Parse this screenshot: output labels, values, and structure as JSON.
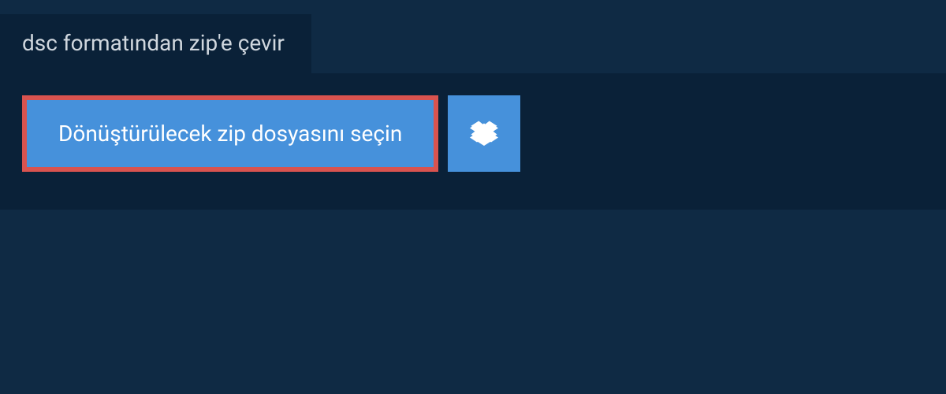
{
  "tab": {
    "title": "dsc formatından zip'e çevir"
  },
  "panel": {
    "select_button_label": "Dönüştürülecek zip dosyasını seçin"
  },
  "colors": {
    "background": "#0f2a44",
    "panel": "#0a2138",
    "button": "#4691db",
    "button_border": "#d9534f",
    "text_light": "#d0d7de",
    "text_white": "#ffffff"
  }
}
